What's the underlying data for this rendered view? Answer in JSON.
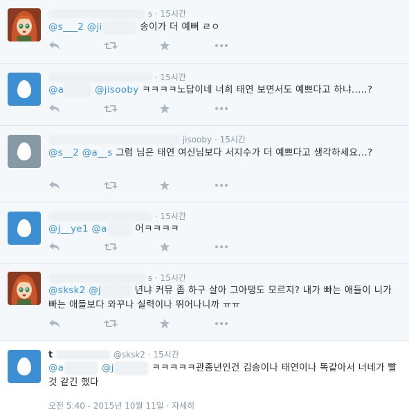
{
  "tweets": [
    {
      "name": "",
      "handle": "s",
      "time": "15시간",
      "mentions": [
        "@s___2",
        "@ji"
      ],
      "text": "송이가 더 예뻐 ㄹㅇ",
      "avatar": "anime-avatar"
    },
    {
      "name": "",
      "handle": "",
      "time": "15시간",
      "mentions": [
        "@a",
        "@jisooby"
      ],
      "text": "ㅋㅋㅋㅋ노답이네 너희 태연 보면서도 예쁘다고 하냐.....?",
      "avatar": "egg-avatar"
    },
    {
      "name": "",
      "handle": "jisooby",
      "time": "15시간",
      "mentions": [
        "@s__2",
        "@a__s"
      ],
      "text": "그럼 님은 태연 여신님보다 서지수가 더 예쁘다고 생각하세요...?",
      "avatar": "egg-avatar-grey"
    },
    {
      "name": "",
      "handle": "",
      "time": "15시간",
      "mentions": [
        "@j__ye1",
        "@a"
      ],
      "text": "어ㅋㅋㅋㅋ",
      "avatar": "egg-avatar"
    },
    {
      "name": "",
      "handle": "s",
      "time": "15시간",
      "mentions": [
        "@sksk2",
        "@j"
      ],
      "text": "년냐 커뮤 좀 하구 살아 그아탱도 모르지? 내가 빠는 애들이 니가 빠는 애들보다 와꾸나 실력이나 뛰어나니까 ㅠㅠ",
      "avatar": "anime-avatar"
    },
    {
      "name": "t",
      "handle": "@sksk2",
      "time": "15시간",
      "mentions": [
        "@a",
        "@j"
      ],
      "text": "ㅋㅋㅋㅋㅋ관종년인건 김송이나 태연이나 똑같아서 너네가 빨 것 같긴 했다",
      "avatar": "egg-avatar",
      "timestamp": "오전 5:40 - 2015년 10월 11일",
      "detail": "자세히"
    }
  ],
  "colors": {
    "link": "#3b94d9",
    "muted": "#8899a6",
    "egg_blue": "#3d8fd3",
    "egg_grey": "#8899a6"
  }
}
